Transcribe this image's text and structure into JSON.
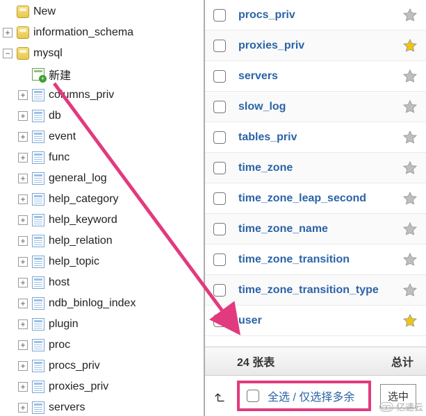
{
  "tree": {
    "root_items": [
      {
        "label": "New",
        "icon": "db",
        "toggle": "blank"
      },
      {
        "label": "information_schema",
        "icon": "db",
        "toggle": "plus"
      },
      {
        "label": "mysql",
        "icon": "db",
        "toggle": "minus"
      }
    ],
    "mysql_new": "新建",
    "mysql_children": [
      "columns_priv",
      "db",
      "event",
      "func",
      "general_log",
      "help_category",
      "help_keyword",
      "help_relation",
      "help_topic",
      "host",
      "ndb_binlog_index",
      "plugin",
      "proc",
      "procs_priv",
      "proxies_priv",
      "servers"
    ]
  },
  "tables": [
    {
      "name": "procs_priv",
      "fav": false
    },
    {
      "name": "proxies_priv",
      "fav": true
    },
    {
      "name": "servers",
      "fav": false
    },
    {
      "name": "slow_log",
      "fav": false
    },
    {
      "name": "tables_priv",
      "fav": false
    },
    {
      "name": "time_zone",
      "fav": false
    },
    {
      "name": "time_zone_leap_second",
      "fav": false
    },
    {
      "name": "time_zone_name",
      "fav": false
    },
    {
      "name": "time_zone_transition",
      "fav": false
    },
    {
      "name": "time_zone_transition_type",
      "fav": false
    },
    {
      "name": "user",
      "fav": true
    }
  ],
  "summary": {
    "count_label": "24 张表",
    "total_label": "总计"
  },
  "footer": {
    "select_all": "全选 / 仅选择多余",
    "dropdown": "选中"
  },
  "watermark": "亿速云"
}
